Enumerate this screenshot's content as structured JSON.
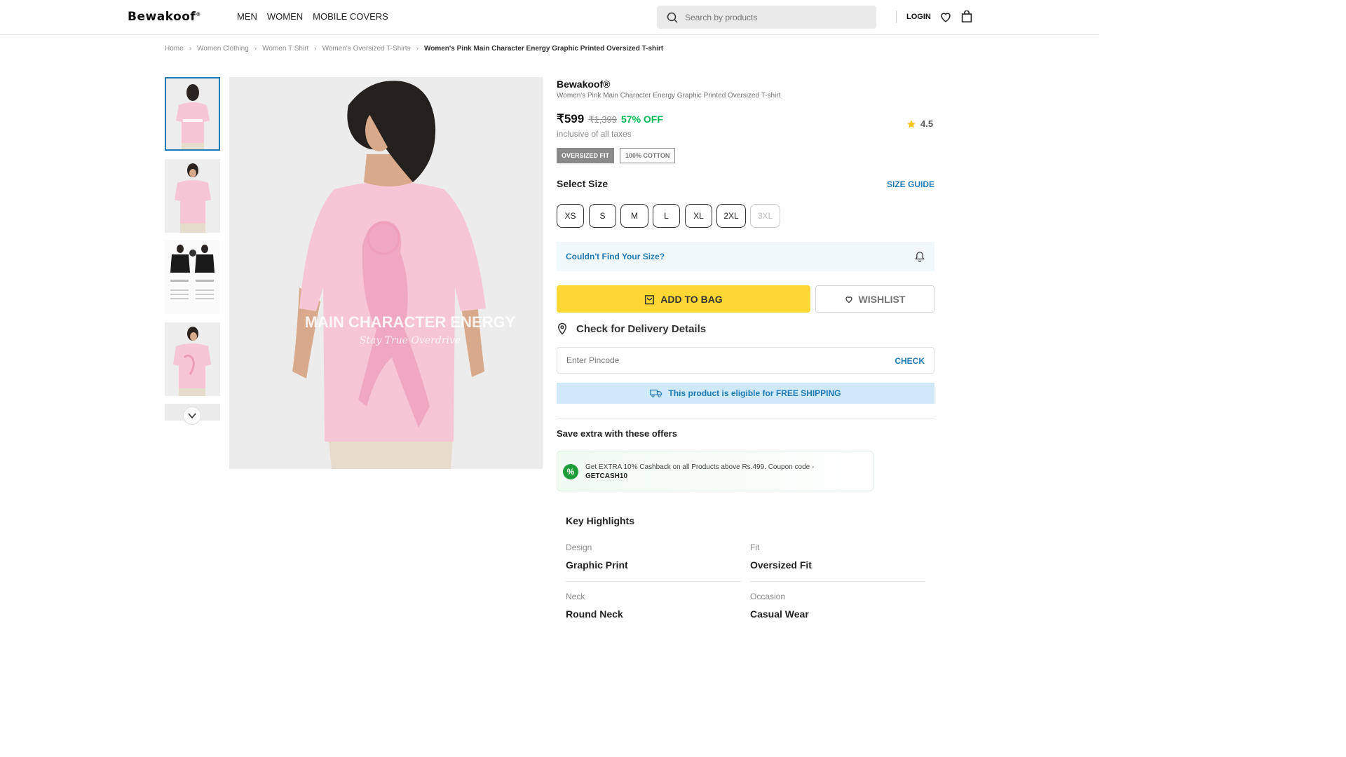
{
  "header": {
    "logo": "Bewakoof",
    "nav": [
      "MEN",
      "WOMEN",
      "MOBILE COVERS"
    ],
    "search_placeholder": "Search by products",
    "login": "LOGIN"
  },
  "breadcrumb": [
    "Home",
    "Women Clothing",
    "Women T Shirt",
    "Women's Oversized T-Shirts",
    "Women's Pink Main Character Energy Graphic Printed Oversized T-shirt"
  ],
  "product": {
    "brand": "Bewakoof®",
    "name": "Women's Pink Main Character Energy Graphic Printed Oversized T-shirt",
    "price": "₹599",
    "mrp": "₹1,399",
    "discount": "57% OFF",
    "tax_note": "inclusive of all taxes",
    "rating": "4.5",
    "tags": [
      "OVERSIZED FIT",
      "100% COTTON"
    ],
    "print_text": "MAIN CHARACTER ENERGY",
    "print_script": "Stay True Overdrive"
  },
  "size": {
    "title": "Select Size",
    "guide": "SIZE GUIDE",
    "options": [
      "XS",
      "S",
      "M",
      "L",
      "XL",
      "2XL",
      "3XL"
    ],
    "not_found": "Couldn't Find Your Size?"
  },
  "actions": {
    "add_to_bag": "ADD TO BAG",
    "wishlist": "WISHLIST"
  },
  "delivery": {
    "title": "Check for Delivery Details",
    "pincode_placeholder": "Enter Pincode",
    "check": "CHECK",
    "shipping": "This product is eligible for FREE SHIPPING"
  },
  "offers": {
    "title": "Save extra with these offers",
    "text": "Get EXTRA 10% Cashback on all Products above Rs.499. Coupon code - ",
    "code": "GETCASH10"
  },
  "highlights": {
    "title": "Key Highlights",
    "items": [
      {
        "label": "Design",
        "value": "Graphic Print"
      },
      {
        "label": "Fit",
        "value": "Oversized Fit"
      },
      {
        "label": "Neck",
        "value": "Round Neck"
      },
      {
        "label": "Occasion",
        "value": "Casual Wear"
      }
    ]
  },
  "colors": {
    "accent_blue": "#207bb4",
    "bag_yellow": "#fdd835",
    "discount_green": "#00b852",
    "shirt_pink": "#f6c6d6"
  }
}
